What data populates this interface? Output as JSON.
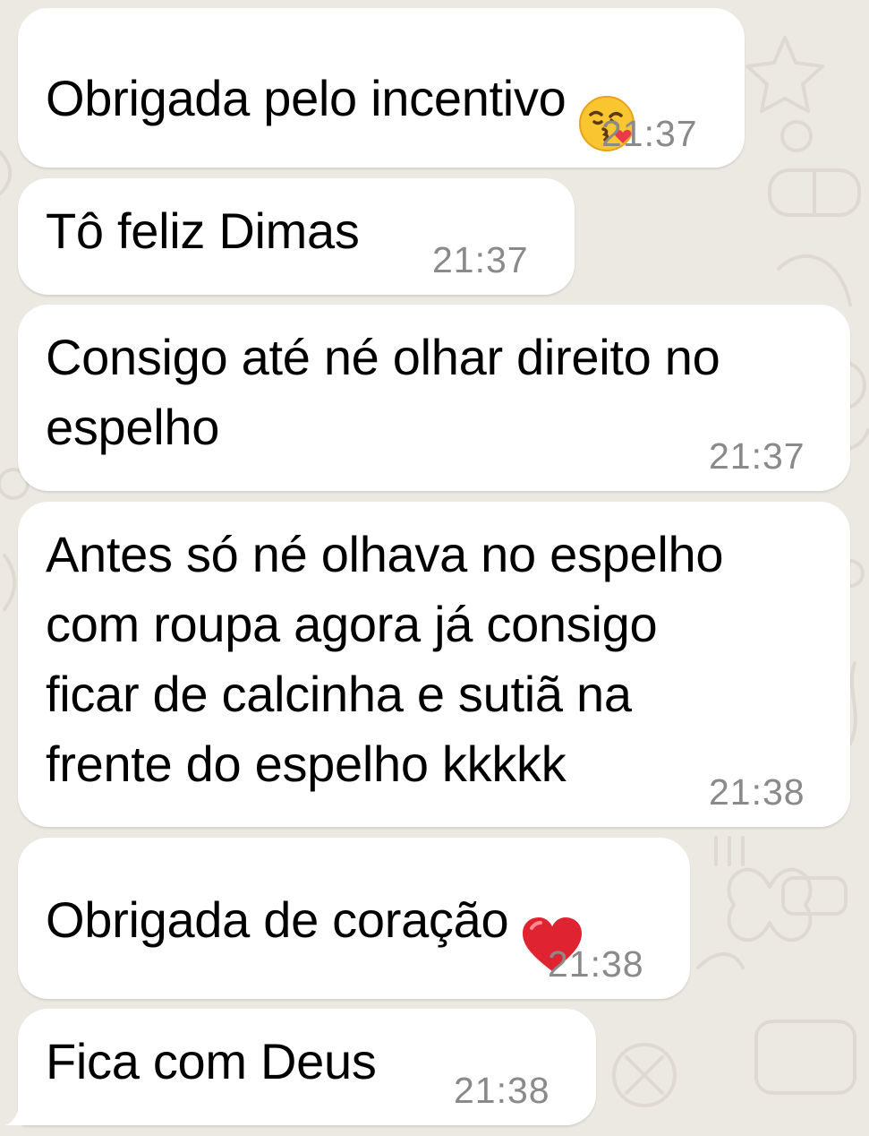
{
  "theme": {
    "background": "#ece9e2",
    "bubble_incoming": "#ffffff",
    "text_color": "#000000",
    "time_color": "#8a8a8a"
  },
  "messages": [
    {
      "text": "Obrigada pelo incentivo",
      "emoji": "kissing-face-with-heart-emoji",
      "time": "21:37"
    },
    {
      "text": "Tô feliz Dimas",
      "time": "21:37"
    },
    {
      "text": "Consigo até né olhar direito no\nespelho",
      "time": "21:37"
    },
    {
      "text": "Antes só né olhava no espelho\ncom roupa agora já consigo\nficar de calcinha e sutiã na\nfrente do espelho kkkkk",
      "time": "21:38"
    },
    {
      "text": "Obrigada de coração",
      "emoji": "red-heart-emoji",
      "time": "21:38"
    },
    {
      "text": "Fica com Deus",
      "time": "21:38"
    }
  ]
}
